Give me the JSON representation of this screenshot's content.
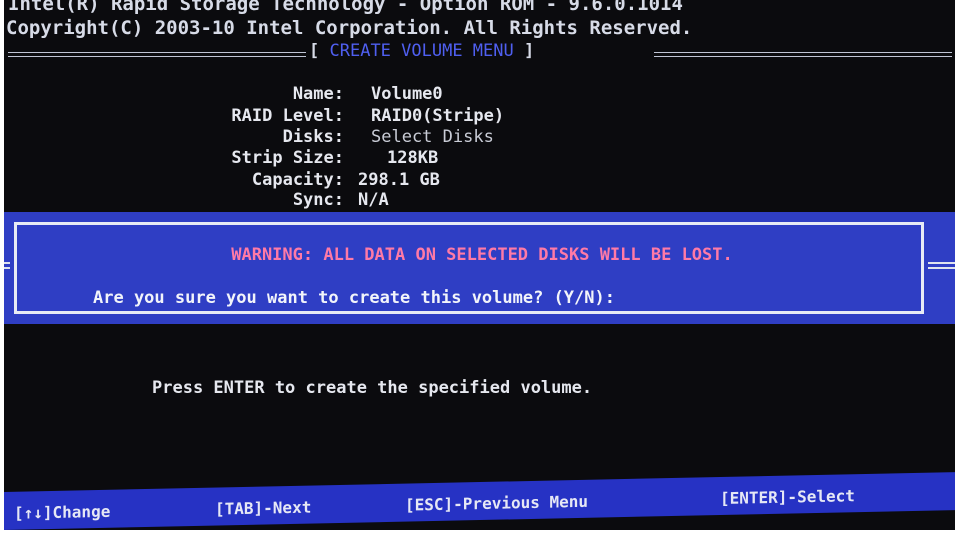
{
  "header": {
    "line1": "Intel(R) Rapid Storage Technology - Option ROM - 9.6.0.1014",
    "line2_copyright": "Copyright(C) 2003-10 Intel Corporation.",
    "line2_rights": "All Rights Reserved."
  },
  "menu": {
    "title": "CREATE VOLUME MENU",
    "bracket_open": "[",
    "bracket_close": "]"
  },
  "fields": [
    {
      "label": "Name:",
      "value": "Volume0"
    },
    {
      "label": "RAID Level:",
      "value": "RAID0(Stripe)"
    },
    {
      "label": "Disks:",
      "value": "Select Disks"
    },
    {
      "label": "Strip Size:",
      "value": "128KB"
    },
    {
      "label": "Capacity:",
      "value": "298.1  GB"
    },
    {
      "label": "Sync:",
      "value": "N/A"
    }
  ],
  "dialog": {
    "warning": "WARNING: ALL DATA ON SELECTED DISKS WILL BE LOST.",
    "prompt": "Are you sure you want to create this volume? (Y/N):"
  },
  "help_text": "Press ENTER to create the specified volume.",
  "footer": {
    "change": "[↑↓]Change",
    "next": "[TAB]-Next",
    "previous": "[ESC]-Previous Menu",
    "select": "[ENTER]-Select"
  },
  "colors": {
    "background": "#0b0b0e",
    "dialog_blue": "#2f3ec4",
    "warning_pink": "#ff7aa6",
    "title_blue": "#4f5ff0",
    "footer_blue": "#2632c4"
  }
}
